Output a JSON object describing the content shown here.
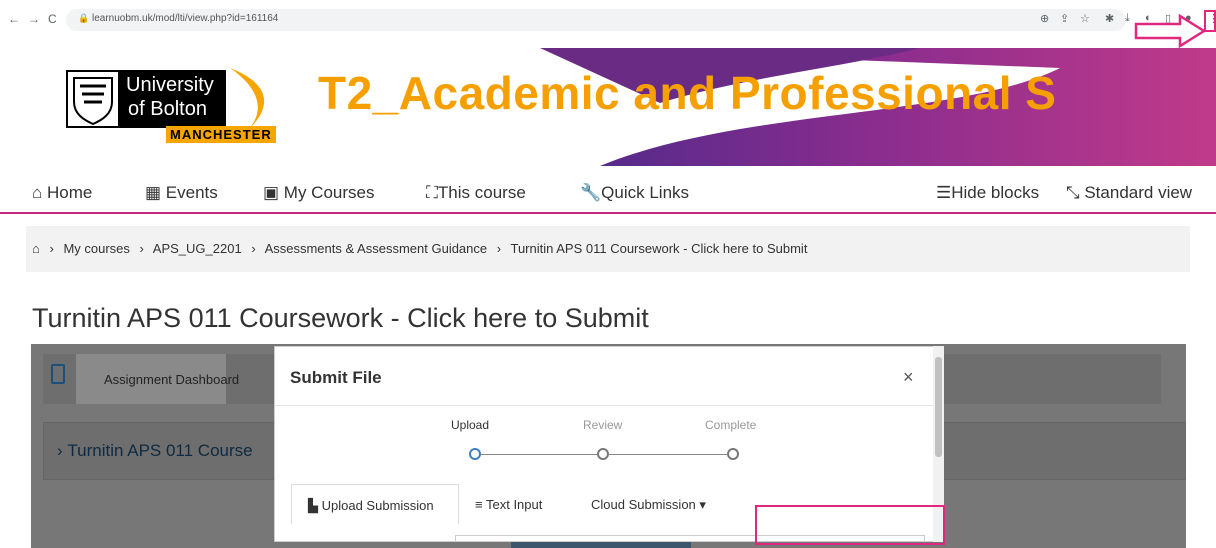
{
  "browser": {
    "url": "learnuobm.uk/mod/lti/view.php?id=161164",
    "back_icon": "←",
    "forward_icon": "→",
    "reload_icon": "C"
  },
  "banner": {
    "university_line1": "University",
    "university_line2": "of Bolton",
    "city": "MANCHESTER",
    "course_title": "T2_Academic and Professional S"
  },
  "nav": {
    "home": "Home",
    "events": "Events",
    "my_courses": "My Courses",
    "this_course": "This course",
    "quick_links": "Quick Links",
    "hide_blocks": "Hide blocks",
    "standard_view": "Standard view"
  },
  "breadcrumb": {
    "items": [
      "My courses",
      "APS_UG_2201",
      "Assessments & Assessment Guidance",
      "Turnitin APS 011 Coursework - Click here to Submit"
    ]
  },
  "page": {
    "title": "Turnitin APS 011 Coursework - Click here to Submit"
  },
  "turnitin": {
    "dashboard_button": "Assignment Dashboard",
    "assignment_label": "Turnitin APS 011 Course"
  },
  "modal": {
    "title": "Submit File",
    "close": "×",
    "steps": [
      "Upload",
      "Review",
      "Complete"
    ],
    "tabs": {
      "upload": "Upload Submission",
      "text": "Text Input",
      "cloud": "Cloud Submission"
    }
  },
  "colors": {
    "accent_pink": "#c3287b",
    "title_orange": "#f5a000",
    "annotation": "#e0287f"
  }
}
